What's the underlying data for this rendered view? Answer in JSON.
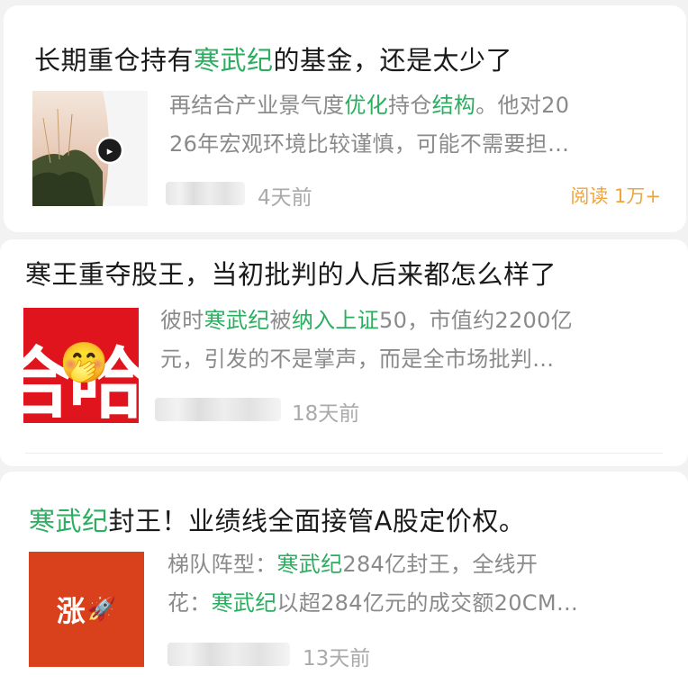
{
  "articles": [
    {
      "title": {
        "pre": "长期重仓持有",
        "hl": "寒武纪",
        "post": "的基金，还是太少了"
      },
      "summary": {
        "line1": {
          "a": "再结合产业景气度",
          "hl1": "优化",
          "b": "持仓",
          "hl2": "结构",
          "c": "。他对20"
        },
        "line2": "26年宏观环境比较谨慎，可能不需要担…"
      },
      "time": "4天前",
      "reads": "阅读 1万+"
    },
    {
      "title": "寒王重夺股王，当初批判的人后来都怎么样了",
      "summary": {
        "line1": {
          "a": "彼时",
          "hl1": "寒武纪",
          "b": "被",
          "hl2": "纳入上证",
          "c": "50，市值约2200亿"
        },
        "line2": "元，引发的不是掌声，而是全市场批判…"
      },
      "thumb": {
        "text": "合哈",
        "emoji": "🤭"
      },
      "time": "18天前"
    },
    {
      "title": {
        "hl": "寒武纪",
        "post": "封王！业绩线全面接管A股定价权。"
      },
      "summary": {
        "line1": {
          "a": "梯队阵型：",
          "hl1": "寒武纪",
          "b": "284亿封王，全线开"
        },
        "line2": {
          "a": "花：",
          "hl1": "寒武纪",
          "b": "以超284亿元的成交额20CM…"
        }
      },
      "thumb": {
        "text": "涨",
        "emoji": "🚀"
      },
      "time": "13天前"
    }
  ],
  "colors": {
    "highlight": "#2bae5f",
    "reads": "#f0a43a",
    "thumb2_bg": "#e0141c",
    "thumb3_bg": "#d9401c"
  }
}
